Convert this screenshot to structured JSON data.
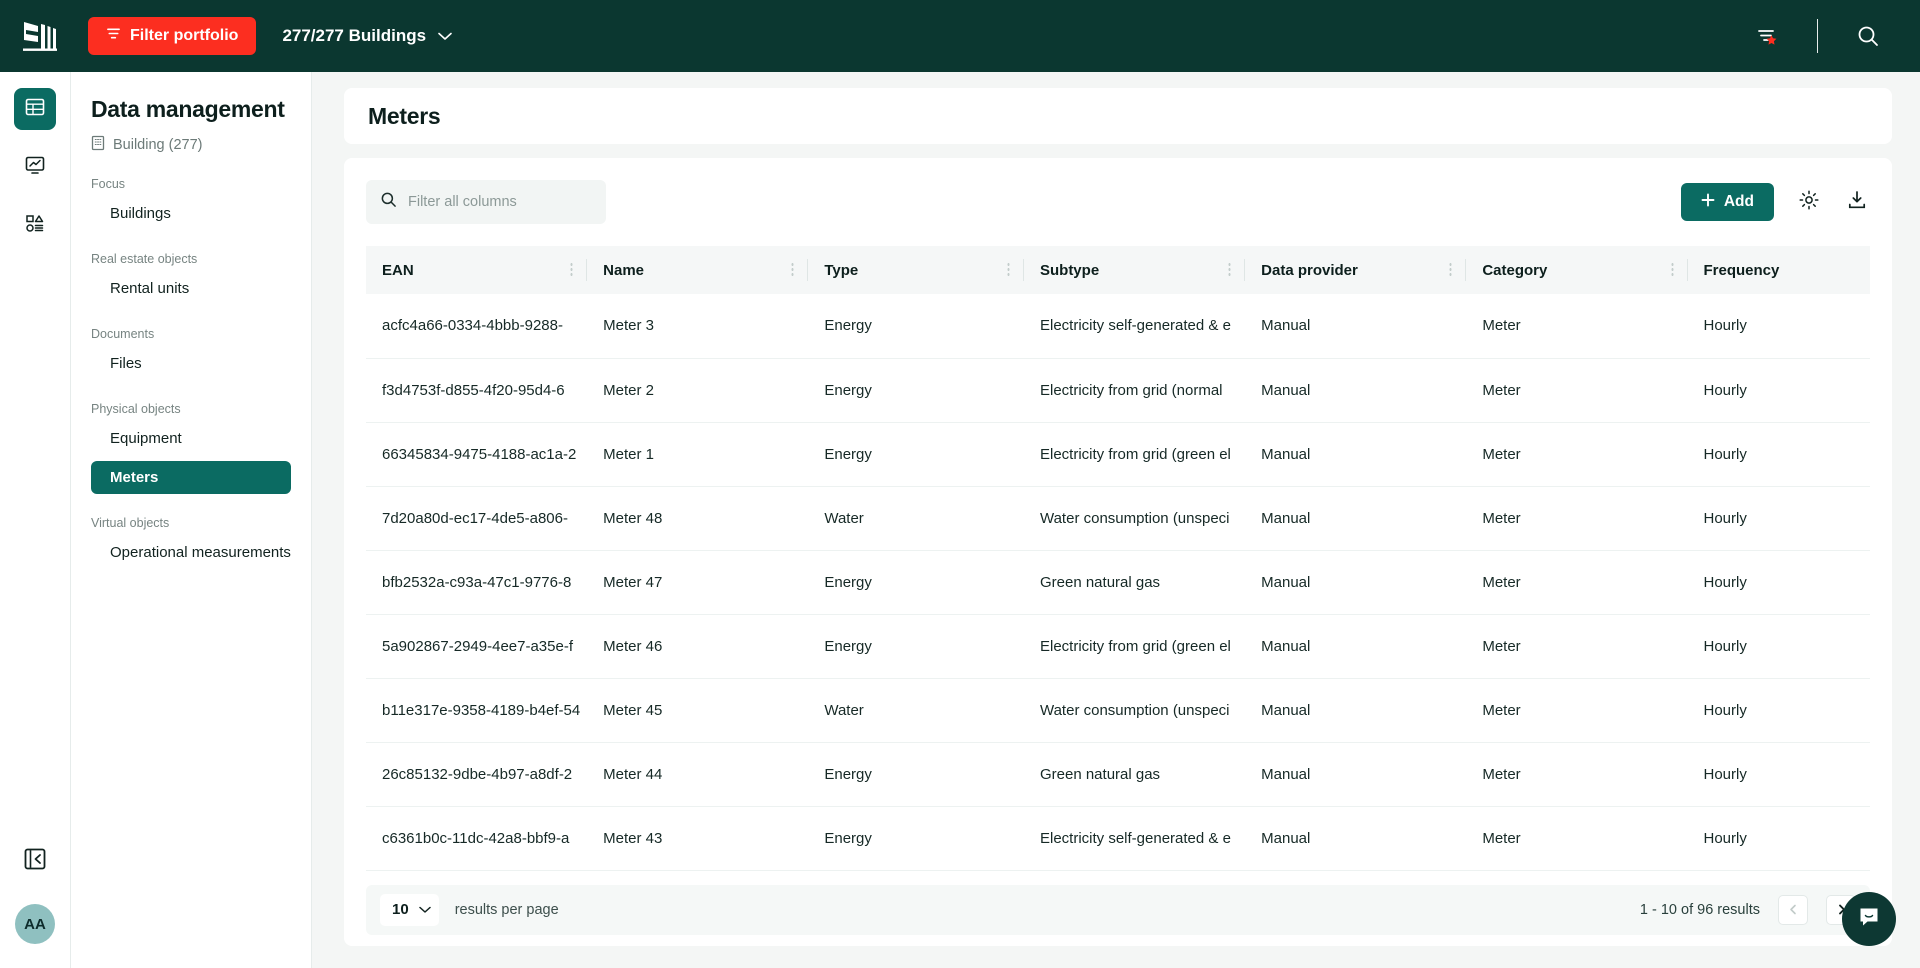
{
  "topbar": {
    "filter_portfolio_label": "Filter portfolio",
    "buildings_selector": "277/277 Buildings"
  },
  "sidebar": {
    "title": "Data management",
    "subtitle": "Building (277)",
    "groups": [
      {
        "label": "Focus",
        "items": [
          {
            "label": "Buildings",
            "active": false
          }
        ]
      },
      {
        "label": "Real estate objects",
        "items": [
          {
            "label": "Rental units",
            "active": false
          }
        ]
      },
      {
        "label": "Documents",
        "items": [
          {
            "label": "Files",
            "active": false
          }
        ]
      },
      {
        "label": "Physical objects",
        "items": [
          {
            "label": "Equipment",
            "active": false
          },
          {
            "label": "Meters",
            "active": true
          }
        ]
      },
      {
        "label": "Virtual objects",
        "items": [
          {
            "label": "Operational measurements",
            "active": false
          }
        ]
      }
    ]
  },
  "rail": {
    "avatar_initials": "AA"
  },
  "page": {
    "title": "Meters"
  },
  "toolbar": {
    "search_placeholder": "Filter all columns",
    "search_value": "",
    "add_label": "Add"
  },
  "table": {
    "columns": [
      "EAN",
      "Name",
      "Type",
      "Subtype",
      "Data provider",
      "Category",
      "Frequency"
    ],
    "rows": [
      [
        "acfc4a66-0334-4bbb-9288-",
        "Meter 3",
        "Energy",
        "Electricity self-generated & e",
        "Manual",
        "Meter",
        "Hourly"
      ],
      [
        "f3d4753f-d855-4f20-95d4-6",
        "Meter 2",
        "Energy",
        "Electricity from grid (normal ",
        "Manual",
        "Meter",
        "Hourly"
      ],
      [
        "66345834-9475-4188-ac1a-2",
        "Meter 1",
        "Energy",
        "Electricity from grid (green el",
        "Manual",
        "Meter",
        "Hourly"
      ],
      [
        "7d20a80d-ec17-4de5-a806-",
        "Meter 48",
        "Water",
        "Water consumption (unspeci",
        "Manual",
        "Meter",
        "Hourly"
      ],
      [
        "bfb2532a-c93a-47c1-9776-8",
        "Meter 47",
        "Energy",
        "Green natural gas",
        "Manual",
        "Meter",
        "Hourly"
      ],
      [
        "5a902867-2949-4ee7-a35e-f",
        "Meter 46",
        "Energy",
        "Electricity from grid (green el",
        "Manual",
        "Meter",
        "Hourly"
      ],
      [
        "b11e317e-9358-4189-b4ef-54",
        "Meter 45",
        "Water",
        "Water consumption (unspeci",
        "Manual",
        "Meter",
        "Hourly"
      ],
      [
        "26c85132-9dbe-4b97-a8df-2",
        "Meter 44",
        "Energy",
        "Green natural gas",
        "Manual",
        "Meter",
        "Hourly"
      ],
      [
        "c6361b0c-11dc-42a8-bbf9-a",
        "Meter 43",
        "Energy",
        "Electricity self-generated & e",
        "Manual",
        "Meter",
        "Hourly"
      ]
    ]
  },
  "pagination": {
    "results_per_page_value": "10",
    "results_per_page_label": "results per page",
    "range_text": "1 -  10 of  96 results"
  },
  "colors": {
    "brand_dark": "#0b3730",
    "accent_red": "#fc2e20",
    "accent_teal": "#0b6b62",
    "avatar_bg": "#8fc0c0"
  }
}
